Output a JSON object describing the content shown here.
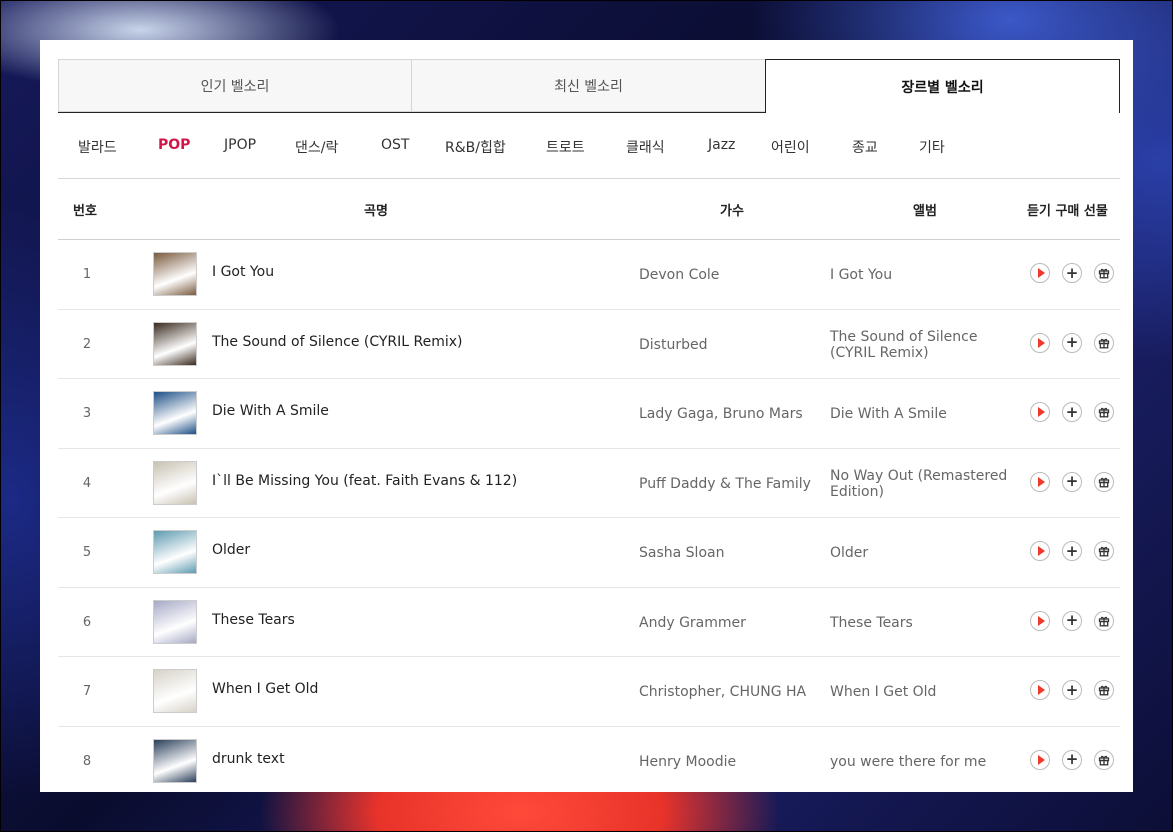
{
  "tabs": [
    {
      "label": "인기 벨소리",
      "active": false
    },
    {
      "label": "최신 벨소리",
      "active": false
    },
    {
      "label": "장르별 벨소리",
      "active": true
    }
  ],
  "genres": [
    {
      "label": "발라드",
      "active": false
    },
    {
      "label": "POP",
      "active": true
    },
    {
      "label": "JPOP",
      "active": false
    },
    {
      "label": "댄스/락",
      "active": false
    },
    {
      "label": "OST",
      "active": false
    },
    {
      "label": "R&B/힙합",
      "active": false
    },
    {
      "label": "트로트",
      "active": false
    },
    {
      "label": "클래식",
      "active": false
    },
    {
      "label": "Jazz",
      "active": false
    },
    {
      "label": "어린이",
      "active": false
    },
    {
      "label": "종교",
      "active": false
    },
    {
      "label": "기타",
      "active": false
    }
  ],
  "table_header": {
    "number": "번호",
    "title": "곡명",
    "artist": "가수",
    "album": "앨범",
    "actions": "듣기 구매 선물"
  },
  "rows": [
    {
      "number": "1",
      "title": "I Got You",
      "artist": "Devon Cole",
      "album": "I Got You",
      "art_color": "#7a5a3e"
    },
    {
      "number": "2",
      "title": "The Sound of Silence (CYRIL Remix)",
      "artist": "Disturbed",
      "album": "The Sound of Silence (CYRIL Remix)",
      "art_color": "#3a2a1e"
    },
    {
      "number": "3",
      "title": "Die With A Smile",
      "artist": "Lady Gaga, Bruno Mars",
      "album": "Die With A Smile",
      "art_color": "#1d4f86"
    },
    {
      "number": "4",
      "title": "I`ll Be Missing You (feat. Faith Evans & 112)",
      "artist": "Puff Daddy & The Family",
      "album": "No Way Out (Remastered Edition)",
      "art_color": "#c9c2b3"
    },
    {
      "number": "5",
      "title": "Older",
      "artist": "Sasha Sloan",
      "album": "Older",
      "art_color": "#5e9ab0"
    },
    {
      "number": "6",
      "title": "These Tears",
      "artist": "Andy Grammer",
      "album": "These Tears",
      "art_color": "#a6a9c6"
    },
    {
      "number": "7",
      "title": "When I Get Old",
      "artist": "Christopher, CHUNG HA",
      "album": "When I Get Old",
      "art_color": "#d6d2c8"
    },
    {
      "number": "8",
      "title": "drunk text",
      "artist": "Henry Moodie",
      "album": "you were there for me",
      "art_color": "#2b3f5a"
    }
  ],
  "colors": {
    "accent": "#d4154a",
    "play_icon": "#ee3a2c"
  }
}
